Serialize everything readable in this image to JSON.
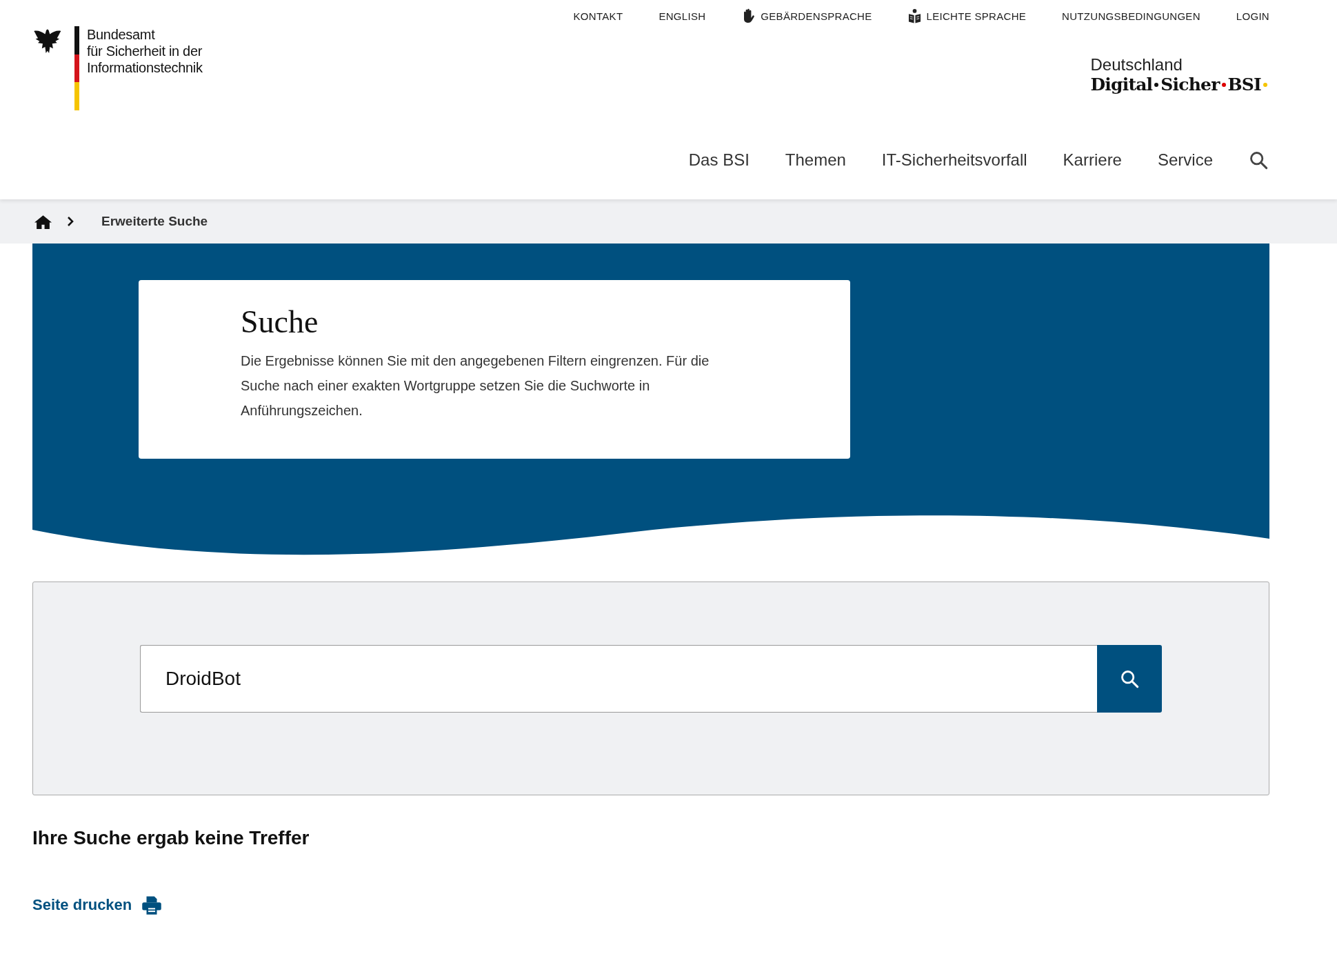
{
  "service_links": [
    {
      "label": "KONTAKT",
      "kind": "plain"
    },
    {
      "label": "ENGLISH",
      "kind": "plain"
    },
    {
      "label": "GEBÄRDENSPRACHE",
      "kind": "hand"
    },
    {
      "label": "LEICHTE SPRACHE",
      "kind": "book"
    },
    {
      "label": "NUTZUNGSBEDINGUNGEN",
      "kind": "plain"
    },
    {
      "label": "LOGIN",
      "kind": "plain"
    }
  ],
  "logo": {
    "lines": [
      "Bundesamt",
      "für Sicherheit in der",
      "Informationstechnik"
    ]
  },
  "brand": {
    "line_1": "Deutschland",
    "words": [
      "Digital",
      "Sicher",
      "BSI"
    ]
  },
  "main_nav": [
    "Das BSI",
    "Themen",
    "IT-Sicherheitsvorfall",
    "Karriere",
    "Service"
  ],
  "breadcrumb": {
    "current": "Erweiterte Suche"
  },
  "hero": {
    "title": "Suche",
    "text": "Die Ergebnisse können Sie mit den angegebenen Filtern eingrenzen. Für die Suche nach einer exakten Wortgruppe setzen Sie die Suchworte in Anführungszeichen."
  },
  "search": {
    "value": "DroidBot"
  },
  "result_message": "Ihre Suche ergab keine Treffer",
  "print_link": "Seite drucken"
}
